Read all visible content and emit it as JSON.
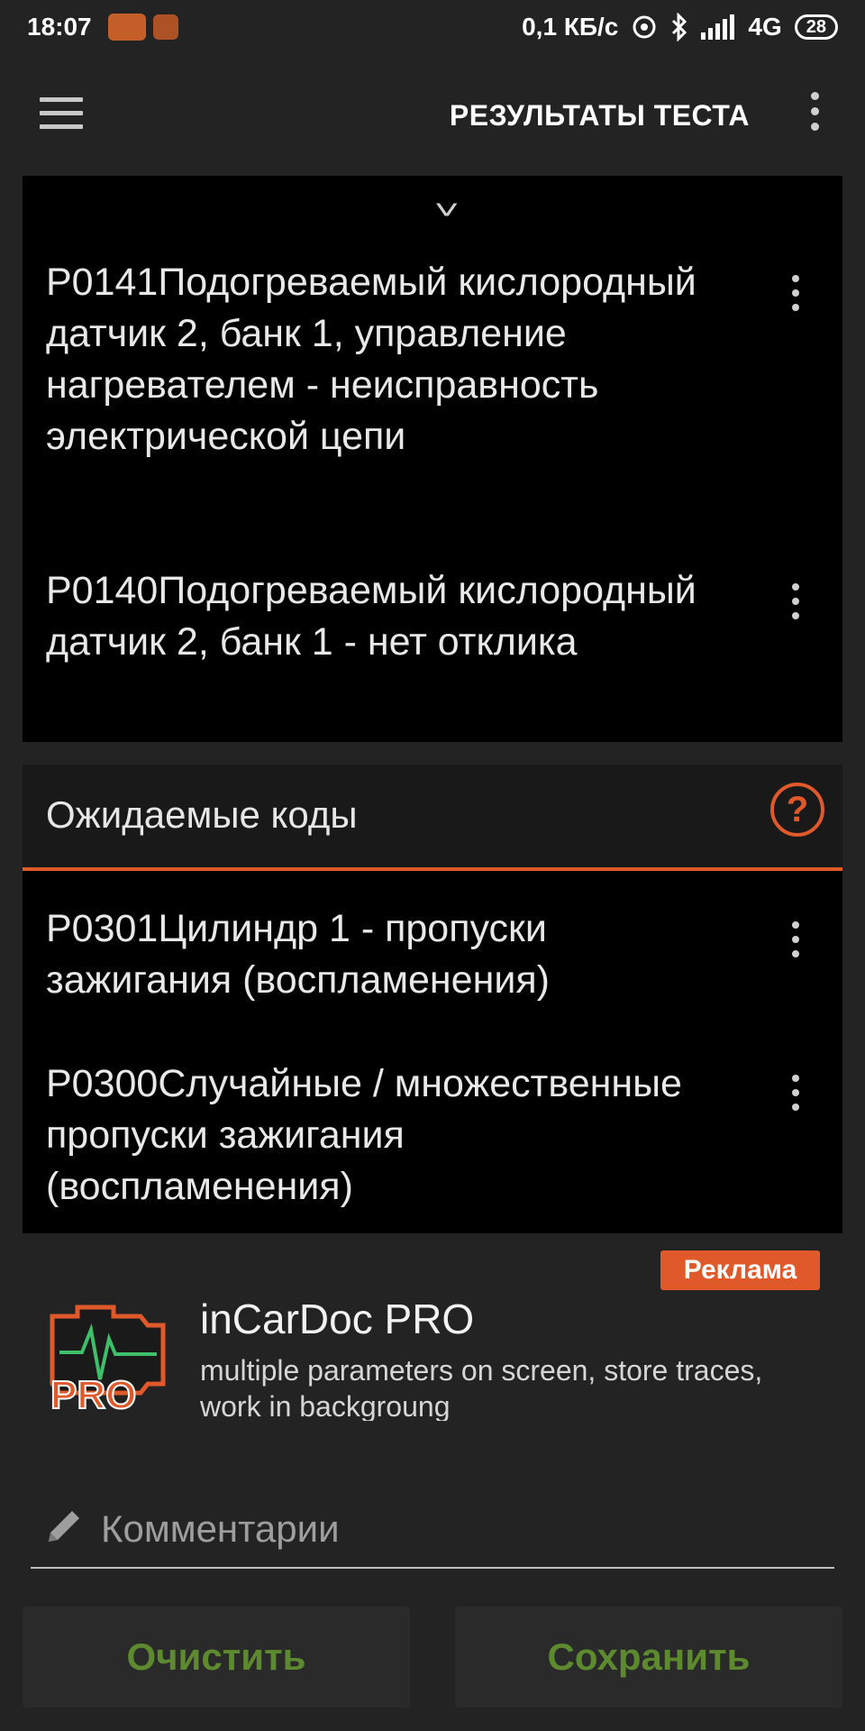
{
  "status_bar": {
    "time": "18:07",
    "network_speed": "0,1 КБ/с",
    "network_type": "4G",
    "battery": "28"
  },
  "app_bar": {
    "title": "РЕЗУЛЬТАТЫ ТЕСТА",
    "menu_icon": "hamburger-icon",
    "overflow_icon": "more-vert-icon"
  },
  "confirmed_codes": {
    "items": [
      {
        "text": "P0141Подогреваемый кислородный датчик 2, банк 1, управление нагревателем - неисправность электрической цепи"
      },
      {
        "text": "P0140Подогреваемый кислородный датчик 2, банк 1 - нет отклика"
      }
    ]
  },
  "pending_codes": {
    "title": "Ожидаемые коды",
    "help_icon": "help-circle-icon",
    "items": [
      {
        "text": "P0301Цилиндр 1 - пропуски зажигания (воспламенения)"
      },
      {
        "text": "P0300Случайные / множественные пропуски зажигания (воспламенения)"
      }
    ]
  },
  "ad": {
    "badge": "Реклама",
    "logo_text": "PRO",
    "title": "inCarDoc PRO",
    "description": "multiple parameters on screen, store traces, work in backgroung"
  },
  "comment": {
    "placeholder": "Комментарии",
    "value": ""
  },
  "actions": {
    "clear_label": "Очистить",
    "save_label": "Сохранить"
  },
  "colors": {
    "accent": "#e0592a",
    "button_text": "#5d8a2e",
    "background": "#232323",
    "card": "#000000"
  }
}
